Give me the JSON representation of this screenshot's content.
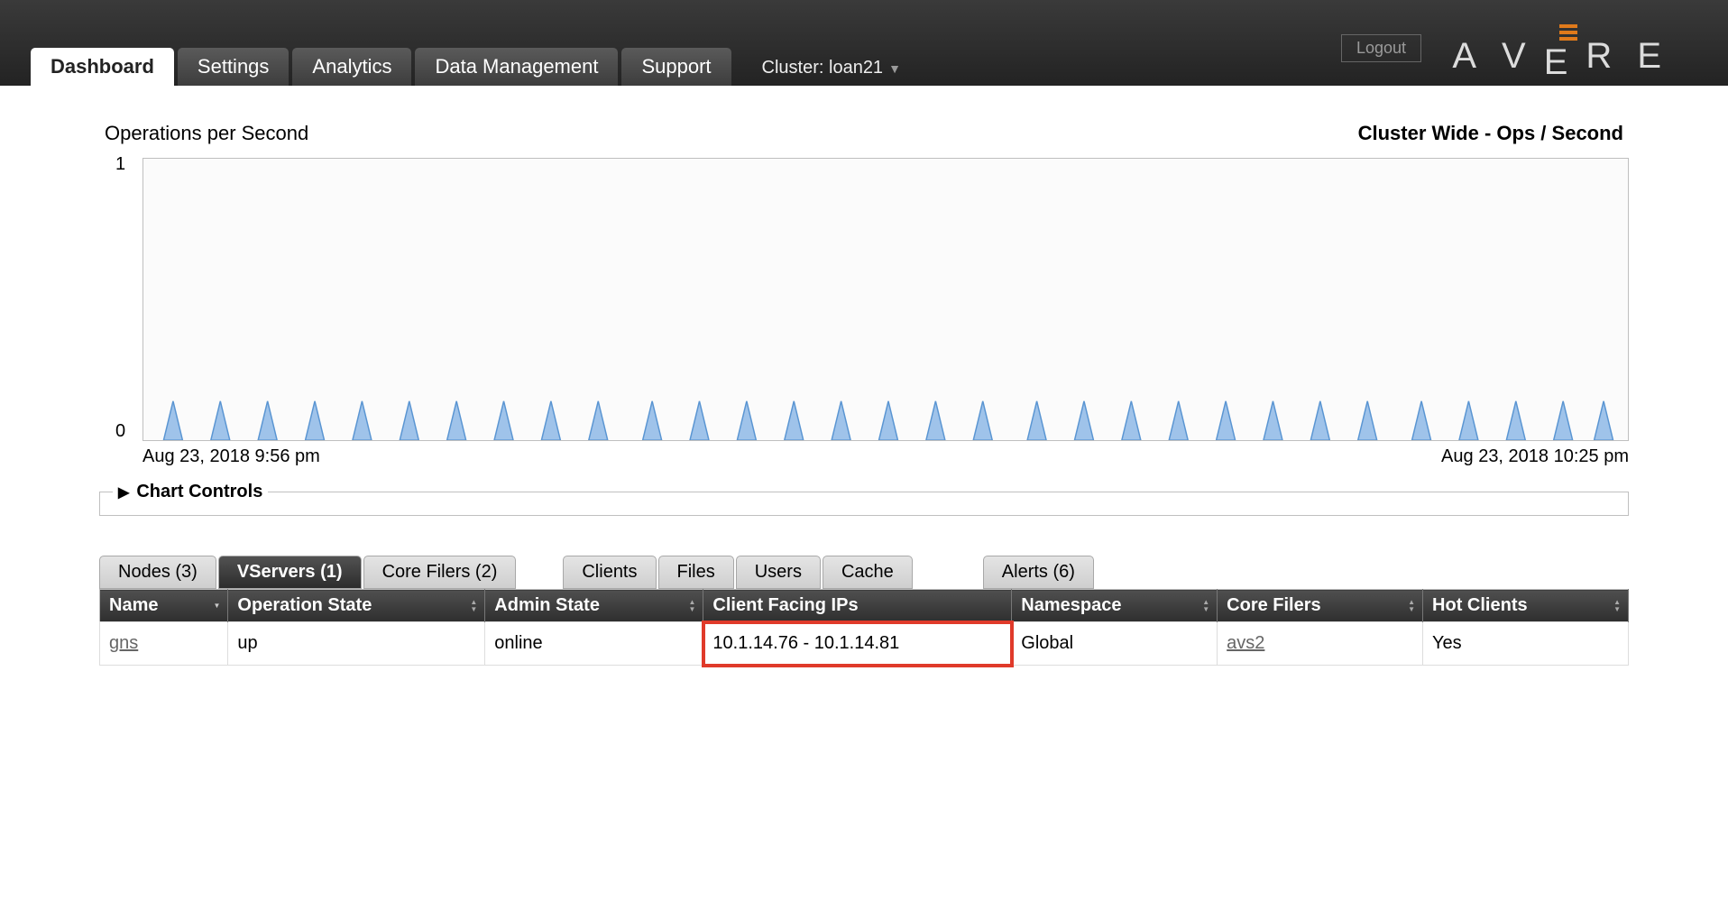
{
  "header": {
    "logout_label": "Logout",
    "brand_letters": [
      "A",
      "V",
      "E",
      "R",
      "E"
    ],
    "tabs": [
      {
        "label": "Dashboard",
        "active": true
      },
      {
        "label": "Settings"
      },
      {
        "label": "Analytics"
      },
      {
        "label": "Data Management"
      },
      {
        "label": "Support"
      }
    ],
    "cluster_prefix": "Cluster:",
    "cluster_name": "loan21"
  },
  "chart": {
    "title_left": "Operations per Second",
    "title_right": "Cluster Wide - Ops / Second",
    "y_max": "1",
    "y_min": "0",
    "x_start": "Aug 23, 2018 9:56 pm",
    "x_end": "Aug 23, 2018 10:25 pm",
    "controls_label": "Chart Controls"
  },
  "chart_data": {
    "type": "line",
    "title": "Operations per Second — Cluster Wide - Ops / Second",
    "xlabel": "",
    "ylabel": "",
    "ylim": [
      0,
      1
    ],
    "x_range": [
      "Aug 23, 2018 9:56 pm",
      "Aug 23, 2018 10:25 pm"
    ],
    "note": "periodic narrow spikes roughly every minute, peak ≈1",
    "series": [
      {
        "name": "ops/sec",
        "values_approx": "~30 evenly-spaced spikes from 0 to ~1 then back to 0"
      }
    ]
  },
  "bottom_tabs": {
    "group1": [
      {
        "label": "Nodes (3)"
      },
      {
        "label": "VServers (1)",
        "active": true
      },
      {
        "label": "Core Filers (2)"
      }
    ],
    "group2": [
      {
        "label": "Clients"
      },
      {
        "label": "Files"
      },
      {
        "label": "Users"
      },
      {
        "label": "Cache"
      }
    ],
    "group3": [
      {
        "label": "Alerts (6)"
      }
    ]
  },
  "table": {
    "columns": [
      {
        "label": "Name",
        "sort": "desc"
      },
      {
        "label": "Operation State",
        "sort": "both"
      },
      {
        "label": "Admin State",
        "sort": "both"
      },
      {
        "label": "Client Facing IPs",
        "highlight": true
      },
      {
        "label": "Namespace",
        "sort": "both"
      },
      {
        "label": "Core Filers",
        "sort": "both"
      },
      {
        "label": "Hot Clients",
        "sort": "both"
      }
    ],
    "rows": [
      {
        "name": "gns",
        "op_state": "up",
        "admin_state": "online",
        "client_ips": "10.1.14.76 - 10.1.14.81",
        "namespace": "Global",
        "core_filers": "avs2",
        "hot_clients": "Yes"
      }
    ]
  }
}
